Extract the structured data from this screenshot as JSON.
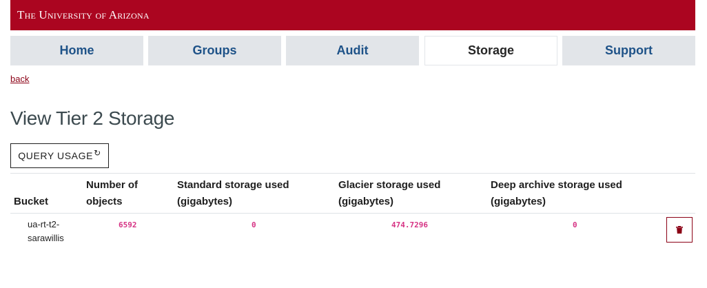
{
  "banner": {
    "title": "The University of Arizona"
  },
  "nav": {
    "tabs": [
      {
        "label": "Home",
        "active": false
      },
      {
        "label": "Groups",
        "active": false
      },
      {
        "label": "Audit",
        "active": false
      },
      {
        "label": "Storage",
        "active": true
      },
      {
        "label": "Support",
        "active": false
      }
    ]
  },
  "back_link": "back",
  "page_title": "View Tier 2 Storage",
  "query_button": {
    "label": "QUERY USAGE",
    "icon": "refresh-icon"
  },
  "table": {
    "headers": {
      "bucket": "Bucket",
      "objects_line1": "Number of",
      "objects_line2": "objects",
      "standard_line1": "Standard storage used",
      "standard_line2": "(gigabytes)",
      "glacier_line1": "Glacier storage used",
      "glacier_line2": "(gigabytes)",
      "deep_line1": "Deep archive storage used",
      "deep_line2": "(gigabytes)"
    },
    "rows": [
      {
        "bucket_line1": "ua-rt-t2-",
        "bucket_line2": "sarawillis",
        "objects": "6592",
        "standard": "0",
        "glacier": "474.7296",
        "deep": "0",
        "delete_icon": "trash-icon"
      }
    ]
  },
  "colors": {
    "brand_red": "#ab0520",
    "nav_blue": "#1e5288",
    "code_pink": "#d63384"
  }
}
